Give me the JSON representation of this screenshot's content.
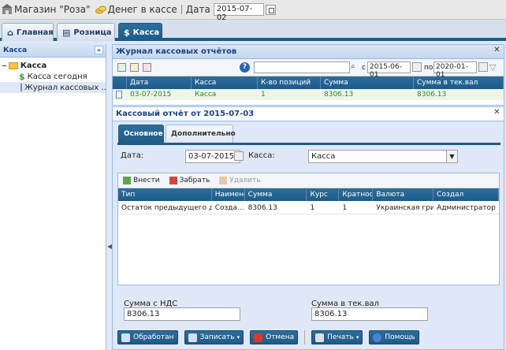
{
  "topbar": {
    "store_label": "Магазин \"Роза\"",
    "cash_label": "Денег в кассе",
    "date_label": "Дата",
    "date_value": "2015-07-02"
  },
  "tabs": [
    {
      "label": "Главная"
    },
    {
      "label": "Розница"
    },
    {
      "label": "Касса"
    }
  ],
  "sidebar": {
    "title": "Касса",
    "root": "Касса",
    "items": [
      {
        "label": "Касса сегодня"
      },
      {
        "label": "Журнал кассовых ..."
      }
    ]
  },
  "journal": {
    "title": "Журнал кассовых отчётов",
    "from_label": "с",
    "from_date": "2015-06-01",
    "to_label": "по",
    "to_date": "2020-01-01",
    "columns": [
      "Дата",
      "Касса",
      "К-во позиций",
      "Сумма",
      "Сумма в тек.вал"
    ],
    "rows": [
      {
        "date": "03-07-2015",
        "cashbox": "Касса",
        "count": "1",
        "sum": "8306.13",
        "sum_cur": "8306.13"
      }
    ]
  },
  "report": {
    "title": "Кассовый отчёт от 2015-07-03",
    "tabs": [
      {
        "label": "Основное"
      },
      {
        "label": "Дополнительно"
      }
    ],
    "date_label": "Дата:",
    "date_value": "03-07-2015",
    "cashbox_label": "Касса:",
    "cashbox_value": "Касса",
    "toolbar": {
      "add": "Внести",
      "take": "Забрать",
      "delete": "Удалить"
    },
    "columns": [
      "Тип",
      "Наименов",
      "Сумма",
      "Курс",
      "Кратность",
      "Валюта",
      "Создал"
    ],
    "rows": [
      {
        "type": "Остаток предыдущего дня",
        "name": "Созда...",
        "sum": "8306.13",
        "rate": "1",
        "mult": "1",
        "currency": "Украинская гри...",
        "creator": "Администратор"
      }
    ],
    "vat_label": "Сумма с НДС",
    "vat_value": "8306.13",
    "cur_label": "Сумма в тек.вал",
    "cur_value": "8306.13",
    "buttons": {
      "processed": "Обработан",
      "save": "Записать",
      "cancel": "Отмена",
      "print": "Печать",
      "help": "Помощь"
    }
  },
  "colors": {
    "accent": "#1e5b87",
    "panel_bg": "#dfe8f6",
    "row_green": "#2a8a2a"
  }
}
